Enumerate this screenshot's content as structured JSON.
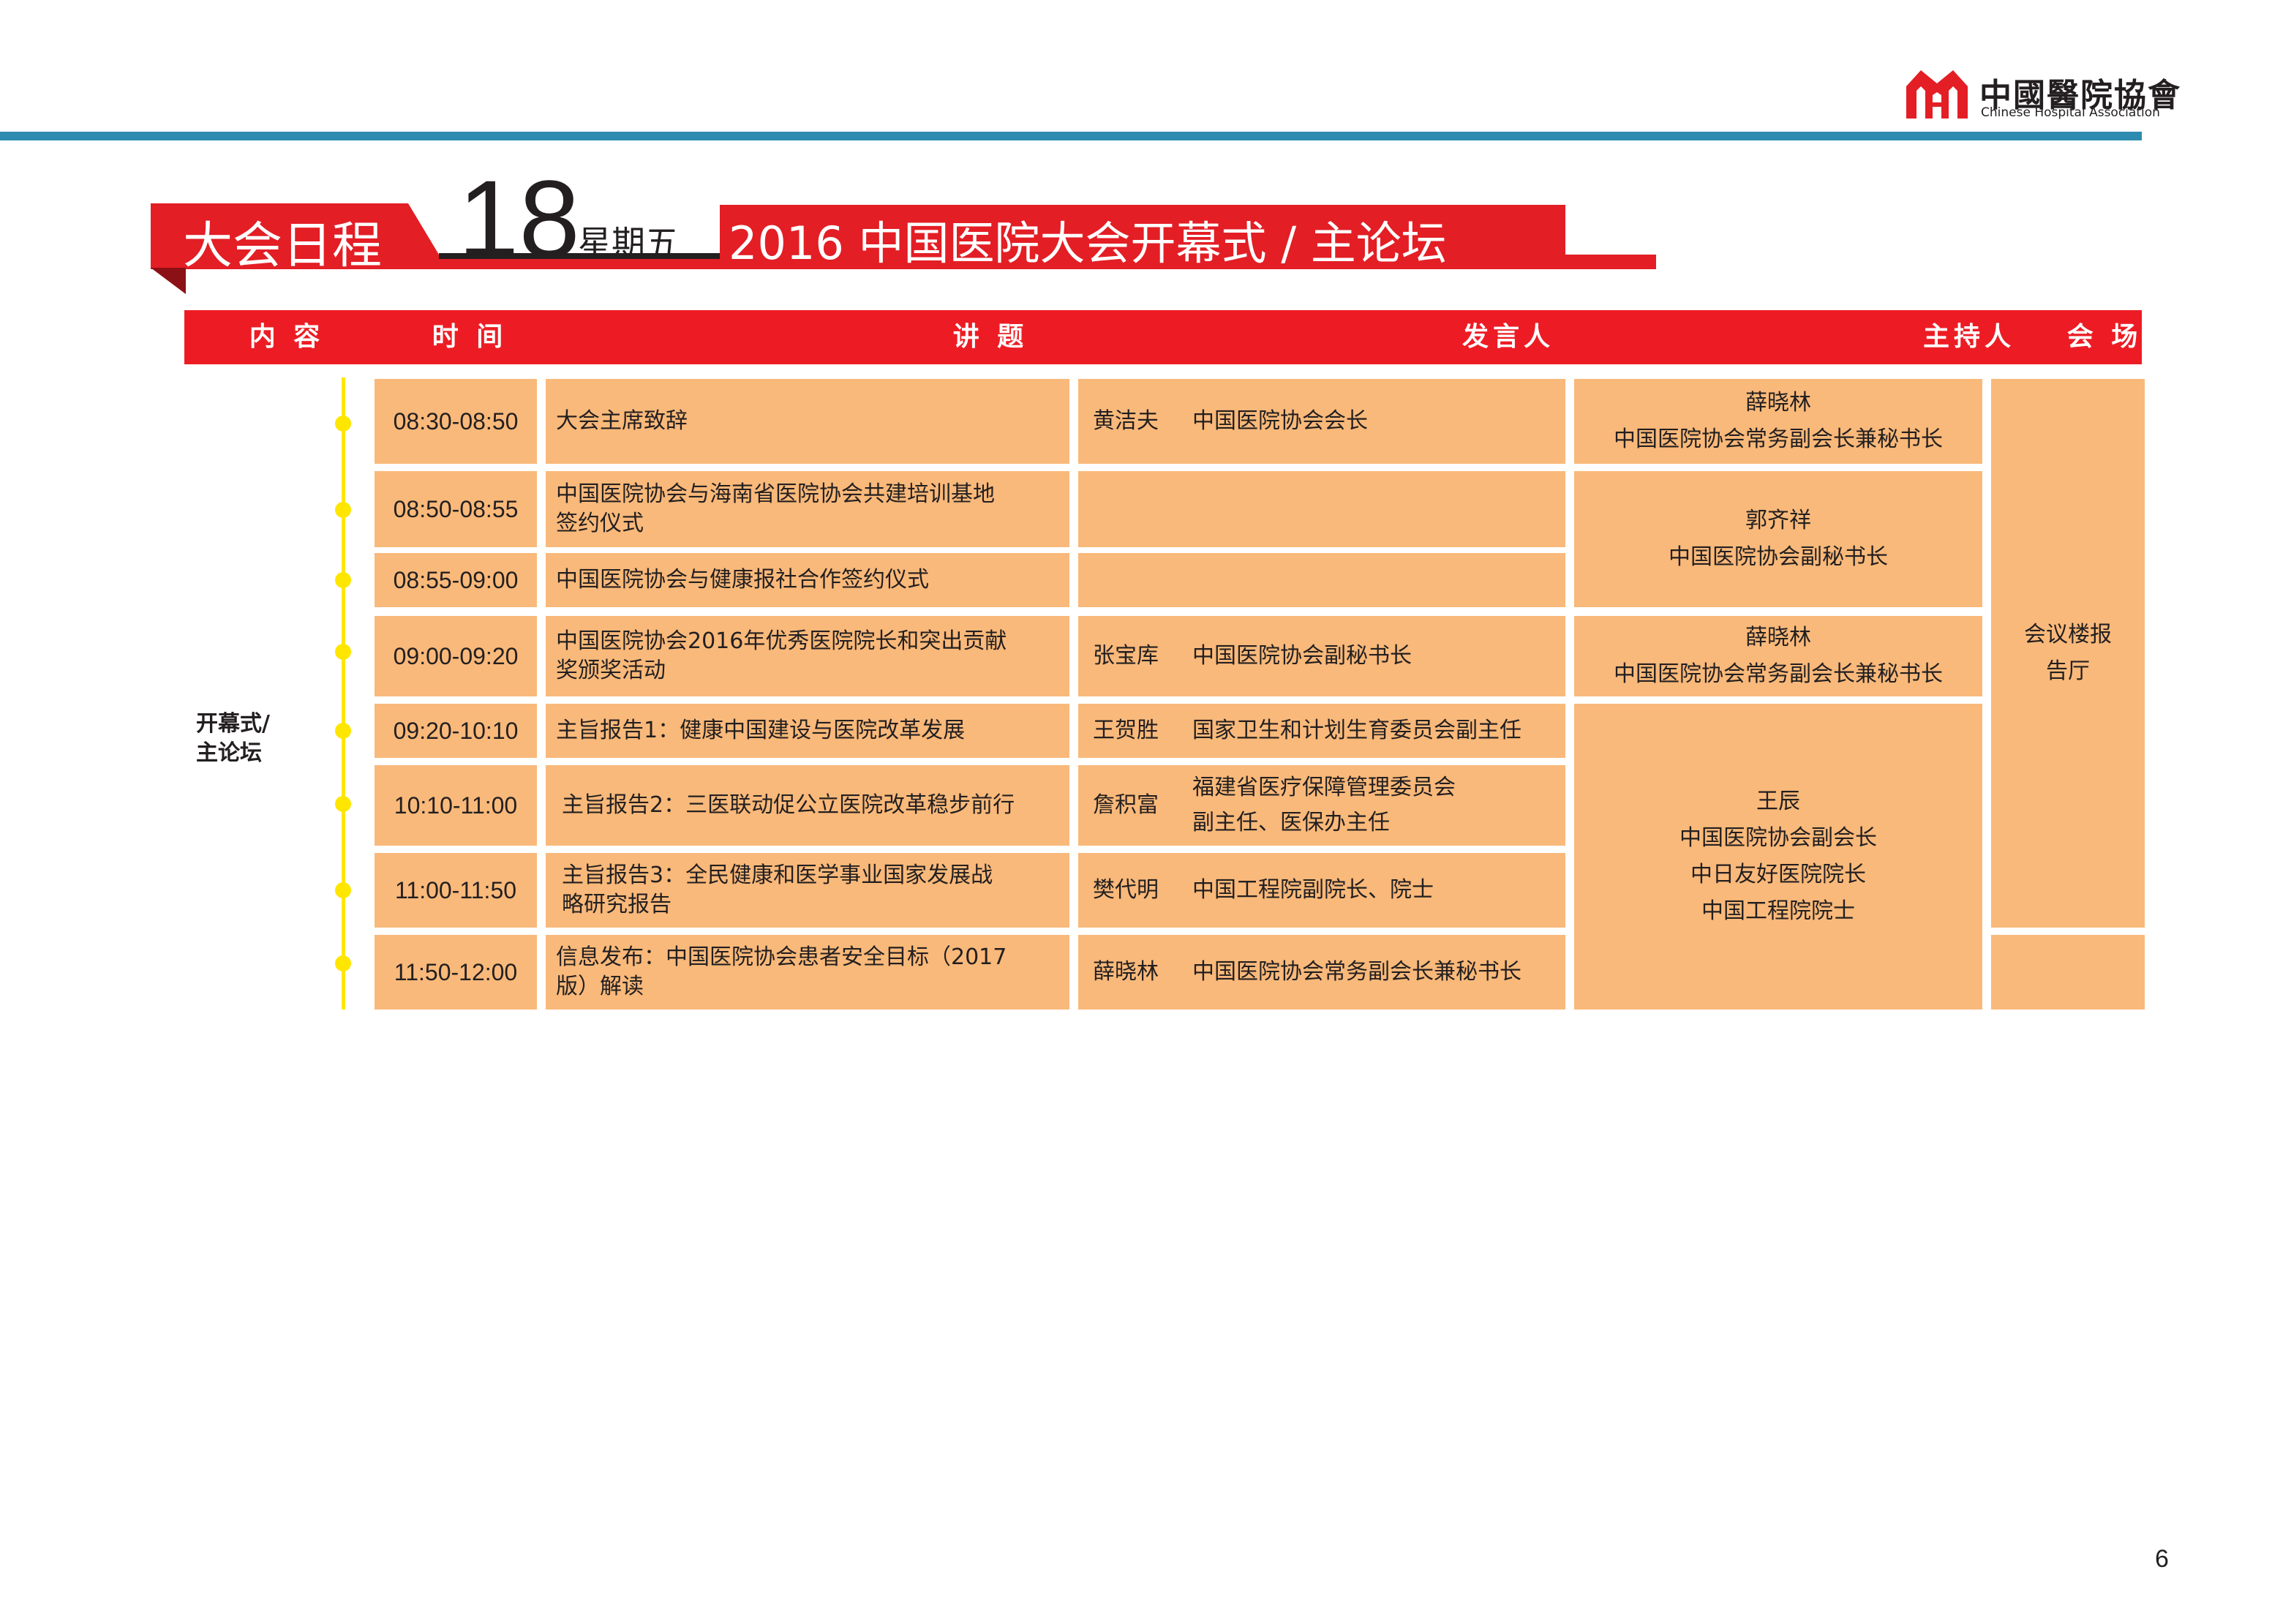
{
  "logo": {
    "name_cn": "中國醫院協會",
    "name_en": "Chinese Hospital Association",
    "mark_icon": "hospital-association-mark",
    "colors": {
      "mark": "#e31e25",
      "rule": "#2e8bb0"
    }
  },
  "banner": {
    "label": "大会日程",
    "day": "18",
    "weekday": "星期五",
    "title": "2016 中国医院大会开幕式 / 主论坛",
    "color": "#e31e25"
  },
  "table": {
    "headers": {
      "content": "内 容",
      "time": "时 间",
      "topic": "讲 题",
      "speaker": "发言人",
      "host": "主持人",
      "venue": "会 场"
    },
    "section_label_line1": "开幕式/",
    "section_label_line2": "主论坛",
    "rows": [
      {
        "time": "08:30-08:50",
        "topic": [
          "大会主席致辞"
        ],
        "speaker_name": "黄洁夫",
        "speaker_title": [
          "中国医院协会会长"
        ]
      },
      {
        "time": "08:50-08:55",
        "topic": [
          "中国医院协会与海南省医院协会共建培训基地",
          "签约仪式"
        ],
        "speaker_name": "",
        "speaker_title": []
      },
      {
        "time": "08:55-09:00",
        "topic": [
          "中国医院协会与健康报社合作签约仪式"
        ],
        "speaker_name": "",
        "speaker_title": []
      },
      {
        "time": "09:00-09:20",
        "topic": [
          "中国医院协会2016年优秀医院院长和突出贡献",
          "奖颁奖活动"
        ],
        "speaker_name": "张宝库",
        "speaker_title": [
          "中国医院协会副秘书长"
        ]
      },
      {
        "time": "09:20-10:10",
        "topic": [
          "主旨报告1：健康中国建设与医院改革发展"
        ],
        "speaker_name": "王贺胜",
        "speaker_title": [
          "国家卫生和计划生育委员会副主任"
        ]
      },
      {
        "time": "10:10-11:00",
        "topic": [
          "主旨报告2：三医联动促公立医院改革稳步前行"
        ],
        "speaker_name": "詹积富",
        "speaker_title": [
          "福建省医疗保障管理委员会",
          "副主任、医保办主任"
        ]
      },
      {
        "time": "11:00-11:50",
        "topic": [
          "主旨报告3：全民健康和医学事业国家发展战",
          "略研究报告"
        ],
        "speaker_name": "樊代明",
        "speaker_title": [
          "中国工程院副院长、院士"
        ]
      },
      {
        "time": "11:50-12:00",
        "topic": [
          "信息发布：中国医院协会患者安全目标（2017",
          "版）解读"
        ],
        "speaker_name": "薛晓林",
        "speaker_title": [
          "中国医院协会常务副会长兼秘书长"
        ]
      }
    ],
    "hosts": [
      {
        "lines": [
          "薛晓林",
          "中国医院协会常务副会长兼秘书长"
        ]
      },
      {
        "lines": [
          "郭齐祥",
          "中国医院协会副秘书长"
        ]
      },
      {
        "lines": [
          "薛晓林",
          "中国医院协会常务副会长兼秘书长"
        ]
      },
      {
        "lines": [
          "王辰",
          "中国医院协会副会长",
          "中日友好医院院长",
          "中国工程院院士"
        ]
      }
    ],
    "venue": {
      "lines": [
        "会议楼报",
        "告厅"
      ]
    },
    "colors": {
      "header": "#ed1c24",
      "cell": "#f9b97a",
      "timeline": "#ffe600"
    }
  },
  "page_number": "6"
}
